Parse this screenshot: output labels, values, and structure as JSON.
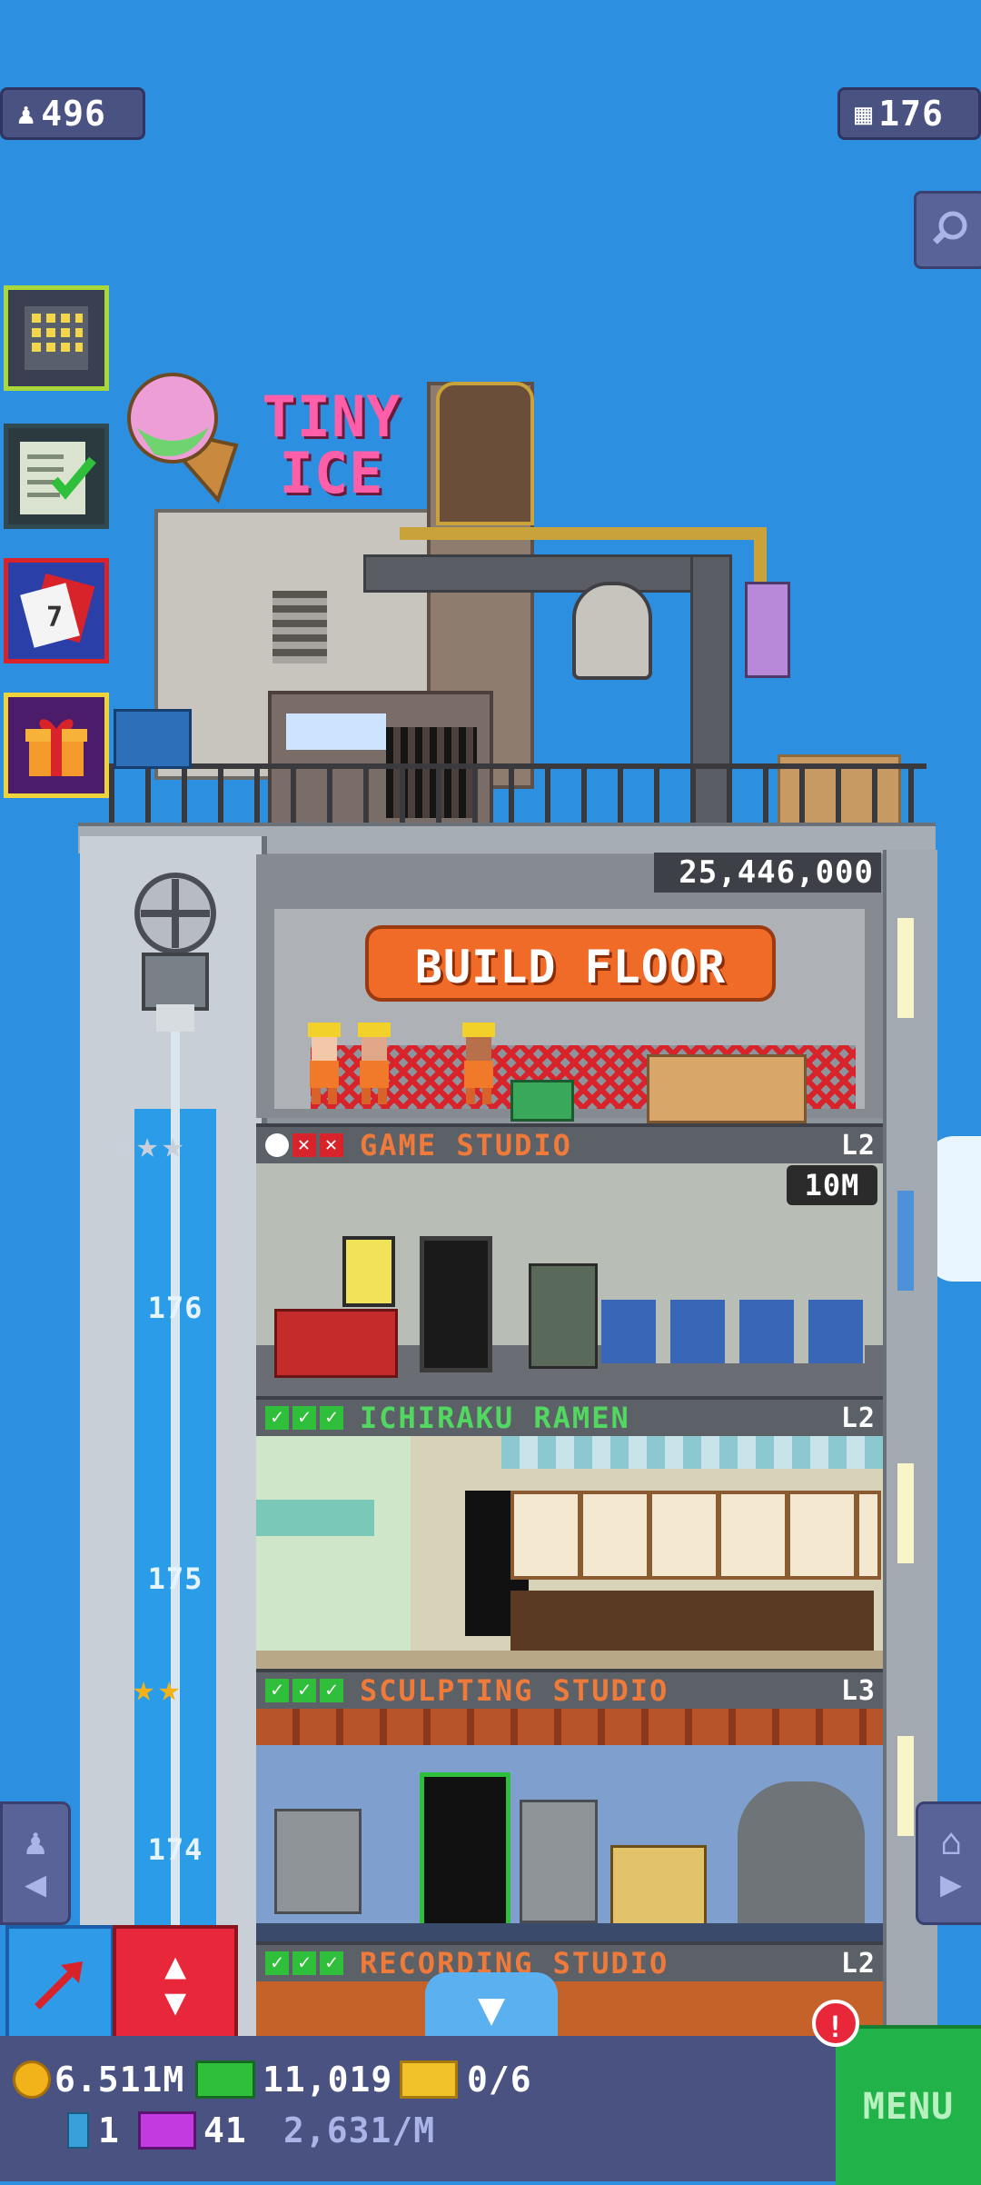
{
  "hud": {
    "population": "496",
    "floors": "176"
  },
  "rooftop": {
    "sign": "TINY ICE"
  },
  "build": {
    "cost": "25,446,000",
    "label": "BUILD FLOOR"
  },
  "floors": [
    {
      "name": "GAME STUDIO",
      "level": "L2",
      "stock": "10M",
      "shaft_number": "176"
    },
    {
      "name": "ICHIRAKU RAMEN",
      "level": "L2",
      "shaft_number": "175"
    },
    {
      "name": "SCULPTING STUDIO",
      "level": "L3",
      "shaft_number": "174"
    },
    {
      "name": "RECORDING STUDIO",
      "level": "L2"
    }
  ],
  "bottom": {
    "coins": "6.511M",
    "bux": "11,019",
    "tickets": "0/6",
    "keys": "1",
    "vip": "41",
    "rate": "2,631/M",
    "menu": "MENU",
    "alert": "!"
  },
  "colors": {
    "sky": "#2d8fe0",
    "build_button": "#f06a28",
    "floor_name": "#f07a3a",
    "ramen_name": "#52d860",
    "menu": "#22b24a"
  }
}
